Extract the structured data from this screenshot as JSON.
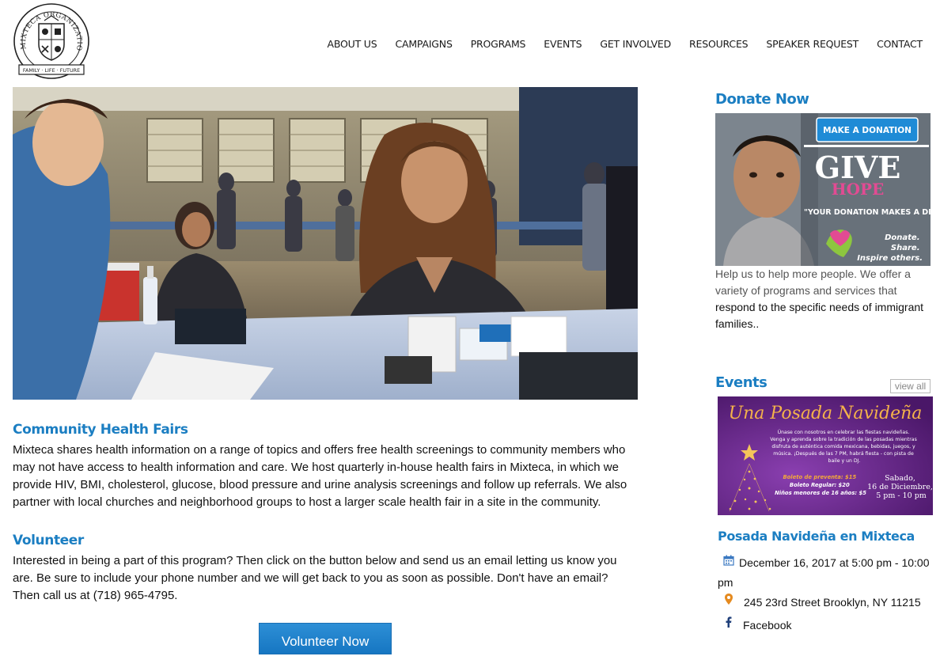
{
  "logo": {
    "ring_text": "MIXTECA ORGANIZATION, INC",
    "banner_text": "FAMILY · LIFE · FUTURE"
  },
  "nav": {
    "items": [
      "ABOUT US",
      "CAMPAIGNS",
      "PROGRAMS",
      "EVENTS",
      "GET INVOLVED",
      "RESOURCES",
      "SPEAKER REQUEST",
      "CONTACT"
    ]
  },
  "health": {
    "title": "Community Health Fairs",
    "body": "Mixteca shares health information on a range of topics and offers free health screenings to community members who may not have access to health information and care. We host quarterly in-house health fairs in Mixteca, in which we provide HIV, BMI, cholesterol, glucose, blood pressure and urine analysis screenings and follow up referrals. We also partner with local churches and neighborhood groups to host a larger scale health fair in a site in the community."
  },
  "volunteer": {
    "title": "Volunteer",
    "body": "Interested in being a part of this program? Then click on the button below and send us an email letting us know you are. Be sure to include your phone number and we will get back to you as soon as possible. Don't have an email? Then call us at (718) 965-4795.",
    "button": "Volunteer Now"
  },
  "donate": {
    "title": "Donate Now",
    "banner": {
      "button": "MAKE A DONATION",
      "give": "GIVE",
      "hope": "HOPE",
      "quote": "\"YOUR DONATION MAKES A DIFFERENCE.\"",
      "tag1": "Donate.",
      "tag2": "Share.",
      "tag3": "Inspire others."
    },
    "text_light": "Help us to help more people. We offer a variety of programs and services that ",
    "text_dark": "respond to the specific needs of immigrant families.."
  },
  "events": {
    "title": "Events",
    "view_all": "view all",
    "poster": {
      "heading": "Una Posada Navideña",
      "line1": "Únase con nosotros en celebrar las fiestas navideñas.",
      "line2": "Venga y aprenda sobre la tradición de las posadas mientras",
      "line3": "disfruta de auténtica comida mexicana, bebidas, juegos, y",
      "line4": "música. ¡Después de las 7 PM, habrá fiesta - con pista de",
      "line5": "baile y un DJ.",
      "price1": "Boleto de preventa: $15",
      "price2": "Boleto Regular: $20",
      "price3": "Niños menores de 16 años: $5",
      "date1": "Sabado,",
      "date2": "16 de Diciembre,",
      "date3": "5 pm - 10 pm"
    },
    "event_title": "Posada Navideña en Mixteca",
    "date_line1": "December 16, 2017 at 5:00 pm - 10:00",
    "date_line2": "pm",
    "address": "245 23rd Street Brooklyn, NY 11215",
    "facebook": "Facebook"
  }
}
